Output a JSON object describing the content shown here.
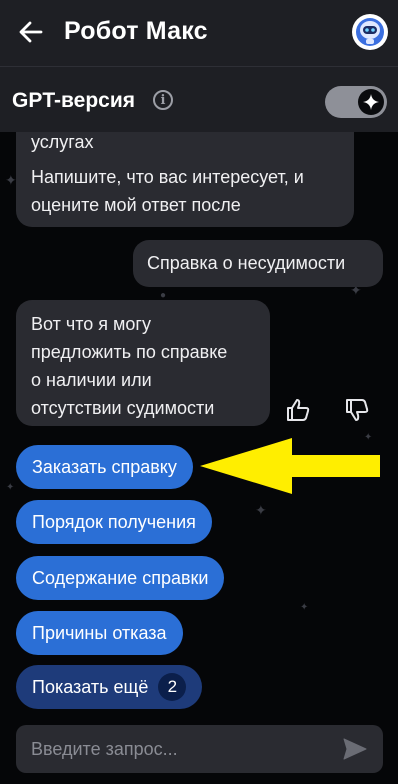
{
  "header": {
    "title": "Робот Макс",
    "back_icon": "arrow-left-icon",
    "avatar_icon": "robot-avatar-icon"
  },
  "gpt_bar": {
    "label": "GPT-версия",
    "info_icon": "info-icon",
    "info_glyph": "i",
    "toggle_on": true,
    "toggle_icon": "sparkle-icon"
  },
  "messages": [
    {
      "from": "bot",
      "lines": [
        "услугах",
        "Напишите, что вас интересует, и",
        "оцените мой ответ после"
      ]
    },
    {
      "from": "user",
      "text": "Справка о несудимости"
    },
    {
      "from": "bot",
      "lines": [
        "Вот что я могу",
        "предложить по справке",
        "о наличии или",
        "отсутствии судимости"
      ]
    }
  ],
  "feedback": {
    "like_icon": "thumbs-up-icon",
    "dislike_icon": "thumbs-down-icon"
  },
  "quick_replies": [
    {
      "label": "Заказать справку"
    },
    {
      "label": "Порядок получения"
    },
    {
      "label": "Содержание справки"
    },
    {
      "label": "Причины отказа"
    }
  ],
  "show_more": {
    "label": "Показать ещё",
    "count": "2"
  },
  "annotation": {
    "icon": "yellow-arrow-left-icon",
    "color": "#ffee00"
  },
  "composer": {
    "placeholder": "Введите запрос...",
    "value": "",
    "send_icon": "send-icon"
  },
  "colors": {
    "accent": "#2b6fd6",
    "header_bg": "#1e1f24",
    "bubble_bg": "#2a2b31",
    "chat_bg": "#050608"
  }
}
